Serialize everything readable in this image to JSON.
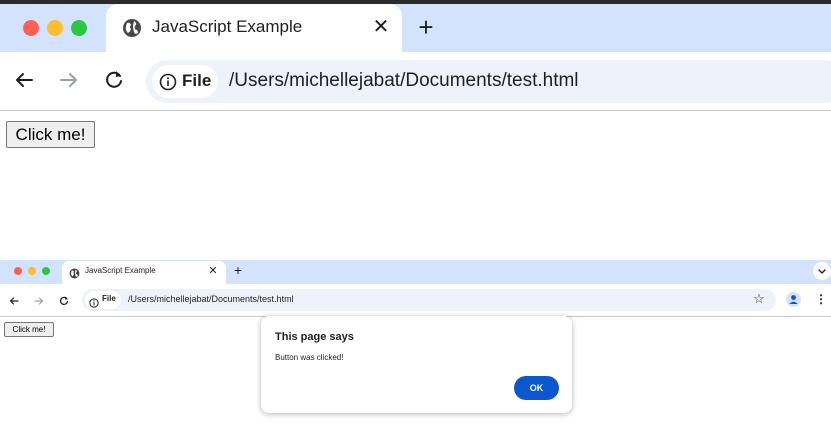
{
  "colors": {
    "tab_strip": "#d3e3fd",
    "omnibox": "#eef2fa",
    "traffic_close": "#ff5f57",
    "traffic_minimize": "#febc2e",
    "traffic_zoom": "#28c840",
    "dialog_ok": "#0b57d0"
  },
  "window_large": {
    "tab": {
      "title": "JavaScript Example",
      "icon": "globe-icon",
      "close_icon": "close-icon",
      "close_glyph": "✕"
    },
    "new_tab_glyph": "+",
    "address": {
      "security_icon": "info-icon",
      "chip_label": "File",
      "url": "/Users/michellejabat/Documents/test.html"
    },
    "page": {
      "button_label": "Click me!"
    }
  },
  "window_small": {
    "tab": {
      "title": "JavaScript Example",
      "icon": "globe-icon",
      "close_icon": "close-icon",
      "close_glyph": "✕"
    },
    "new_tab_glyph": "+",
    "address": {
      "security_icon": "info-icon",
      "chip_label": "File",
      "url": "/Users/michellejabat/Documents/test.html"
    },
    "toolbar_icons": [
      "star-icon",
      "profile-icon",
      "menu-icon"
    ],
    "star_glyph": "☆",
    "menu_glyph": "⋮",
    "page": {
      "button_label": "Click me!"
    },
    "alert": {
      "title": "This page says",
      "message": "Button was clicked!",
      "ok_label": "OK"
    }
  }
}
